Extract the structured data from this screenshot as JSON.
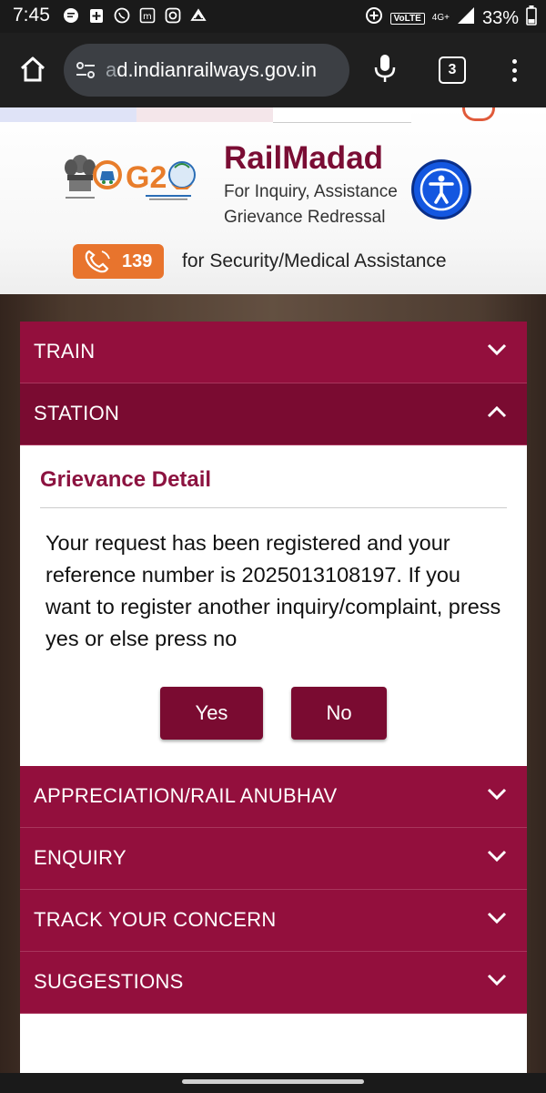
{
  "status_bar": {
    "time": "7:45",
    "network": "VoLTE",
    "signal_label": "4G+",
    "battery": "33%"
  },
  "browser": {
    "url": "ad.indianrailways.gov.in",
    "tab_count": "3"
  },
  "header": {
    "brand": "RailMadad",
    "subtitle_line1": "For Inquiry, Assistance",
    "subtitle_line2": "Grievance Redressal",
    "helpline_number": "139",
    "helpline_text": "for Security/Medical Assistance",
    "accent_color": "#7a0d34",
    "helpline_color": "#e8742d"
  },
  "accordion": {
    "items": [
      {
        "label": "TRAIN",
        "expanded": false
      },
      {
        "label": "STATION",
        "expanded": true
      },
      {
        "label": "APPRECIATION/RAIL ANUBHAV",
        "expanded": false
      },
      {
        "label": "ENQUIRY",
        "expanded": false
      },
      {
        "label": "TRACK YOUR CONCERN",
        "expanded": false
      },
      {
        "label": "SUGGESTIONS",
        "expanded": false
      }
    ],
    "item_color": "#930f3d",
    "active_color": "#7a0b31"
  },
  "grievance": {
    "title": "Grievance Detail",
    "message": "Your request has been registered and your reference number is 2025013108197. If you want to register another inquiry/complaint, press yes or else press no",
    "yes_label": "Yes",
    "no_label": "No"
  }
}
